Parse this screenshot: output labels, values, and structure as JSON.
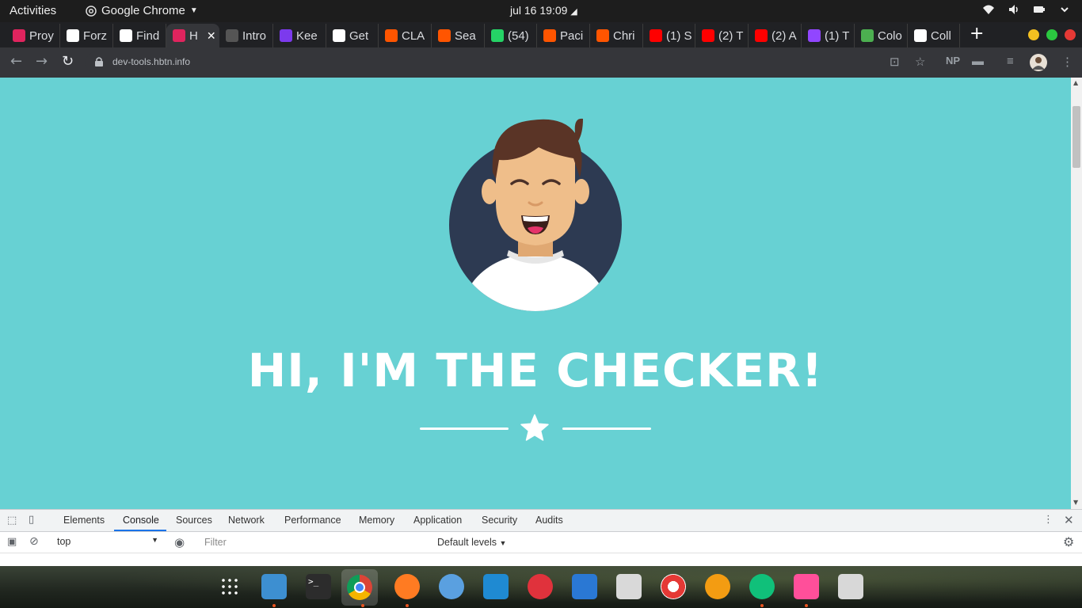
{
  "system_bar": {
    "activities": "Activities",
    "app_name": "Google Chrome",
    "clock": "jul 16  19:09"
  },
  "tabs": [
    {
      "label": "Proy",
      "icon": "repo-icon",
      "color": "#e0245e"
    },
    {
      "label": "Forz",
      "icon": "holberton-icon",
      "color": "#ffffff"
    },
    {
      "label": "Find",
      "icon": "holberton-icon",
      "color": "#ffffff"
    },
    {
      "label": "H",
      "icon": "repo-icon",
      "color": "#e0245e",
      "active": true
    },
    {
      "label": "Intro",
      "icon": "book-icon",
      "color": "#555555"
    },
    {
      "label": "Kee",
      "icon": "rocket-icon",
      "color": "#7c3aed"
    },
    {
      "label": "Get",
      "icon": "holberton-icon",
      "color": "#ffffff"
    },
    {
      "label": "CLA",
      "icon": "soundcloud-icon",
      "color": "#ff5500"
    },
    {
      "label": "Sea",
      "icon": "soundcloud-icon",
      "color": "#ff5500"
    },
    {
      "label": "(54)",
      "icon": "whatsapp-icon",
      "color": "#25d366"
    },
    {
      "label": "Paci",
      "icon": "soundcloud-icon",
      "color": "#ff5500"
    },
    {
      "label": "Chri",
      "icon": "soundcloud-icon",
      "color": "#ff5500"
    },
    {
      "label": "(1) S",
      "icon": "youtube-icon",
      "color": "#ff0000"
    },
    {
      "label": "(2) T",
      "icon": "youtube-icon",
      "color": "#ff0000"
    },
    {
      "label": "(2) A",
      "icon": "youtube-icon",
      "color": "#ff0000"
    },
    {
      "label": "(1) T",
      "icon": "twitch-icon",
      "color": "#9146ff"
    },
    {
      "label": "Colo",
      "icon": "colorhunt-icon",
      "color": "#4caf50"
    },
    {
      "label": "Coll",
      "icon": "chrome-icon",
      "color": "#ffffff"
    }
  ],
  "toolbar": {
    "url": "dev-tools.hbtn.info",
    "np_label": "NP"
  },
  "page": {
    "title": "HI, I'M THE CHECKER!",
    "background": "#67d1d3"
  },
  "devtools": {
    "tabs": [
      "Elements",
      "Console",
      "Sources",
      "Network",
      "Performance",
      "Memory",
      "Application",
      "Security",
      "Audits"
    ],
    "active_tab": "Console",
    "context": "top",
    "filter_placeholder": "Filter",
    "levels": "Default levels"
  },
  "dock": [
    {
      "name": "app-grid-icon"
    },
    {
      "name": "files-icon"
    },
    {
      "name": "terminal-icon"
    },
    {
      "name": "chrome-icon",
      "active": true
    },
    {
      "name": "firefox-icon"
    },
    {
      "name": "remote-desktop-icon"
    },
    {
      "name": "vscode-icon"
    },
    {
      "name": "music-icon"
    },
    {
      "name": "writer-icon"
    },
    {
      "name": "installer-icon"
    },
    {
      "name": "help-icon"
    },
    {
      "name": "amazon-icon"
    },
    {
      "name": "update-icon"
    },
    {
      "name": "video-editor-icon"
    },
    {
      "name": "trash-icon"
    }
  ]
}
